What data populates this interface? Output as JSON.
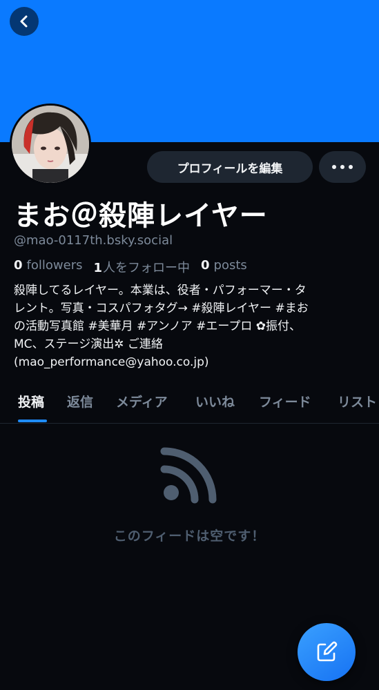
{
  "profile": {
    "display_name": "まお＠殺陣レイヤー",
    "handle": "@mao-0117th.bsky.social",
    "banner_color": "#0a7aff",
    "stats": {
      "followers_count": "0",
      "followers_label": "followers",
      "following_count": "1",
      "following_label": "人をフォロー中",
      "posts_count": "0",
      "posts_label": "posts"
    },
    "bio": "殺陣してるレイヤー。本業は、役者・パフォーマー・タ\nレント。写真・コスパフォタグ→ #殺陣レイヤー #まお\nの活動写真館 #美華月 #アンノア #エープロ ✿振付、\nMC、ステージ演出✲ ご連絡\n(mao_performance@yahoo.co.jp)"
  },
  "actions": {
    "edit_profile_label": "プロフィールを編集",
    "more_icon": "ellipsis-icon",
    "back_icon": "chevron-left-icon"
  },
  "tabs": {
    "items": [
      "投稿",
      "返信",
      "メディア",
      "いいね",
      "フィード",
      "リスト"
    ],
    "active_index": 0
  },
  "feed": {
    "empty_icon": "rss-icon",
    "empty_message": "このフィードは空です！"
  },
  "compose": {
    "icon": "compose-icon",
    "accent_color": "#1f8cff"
  }
}
